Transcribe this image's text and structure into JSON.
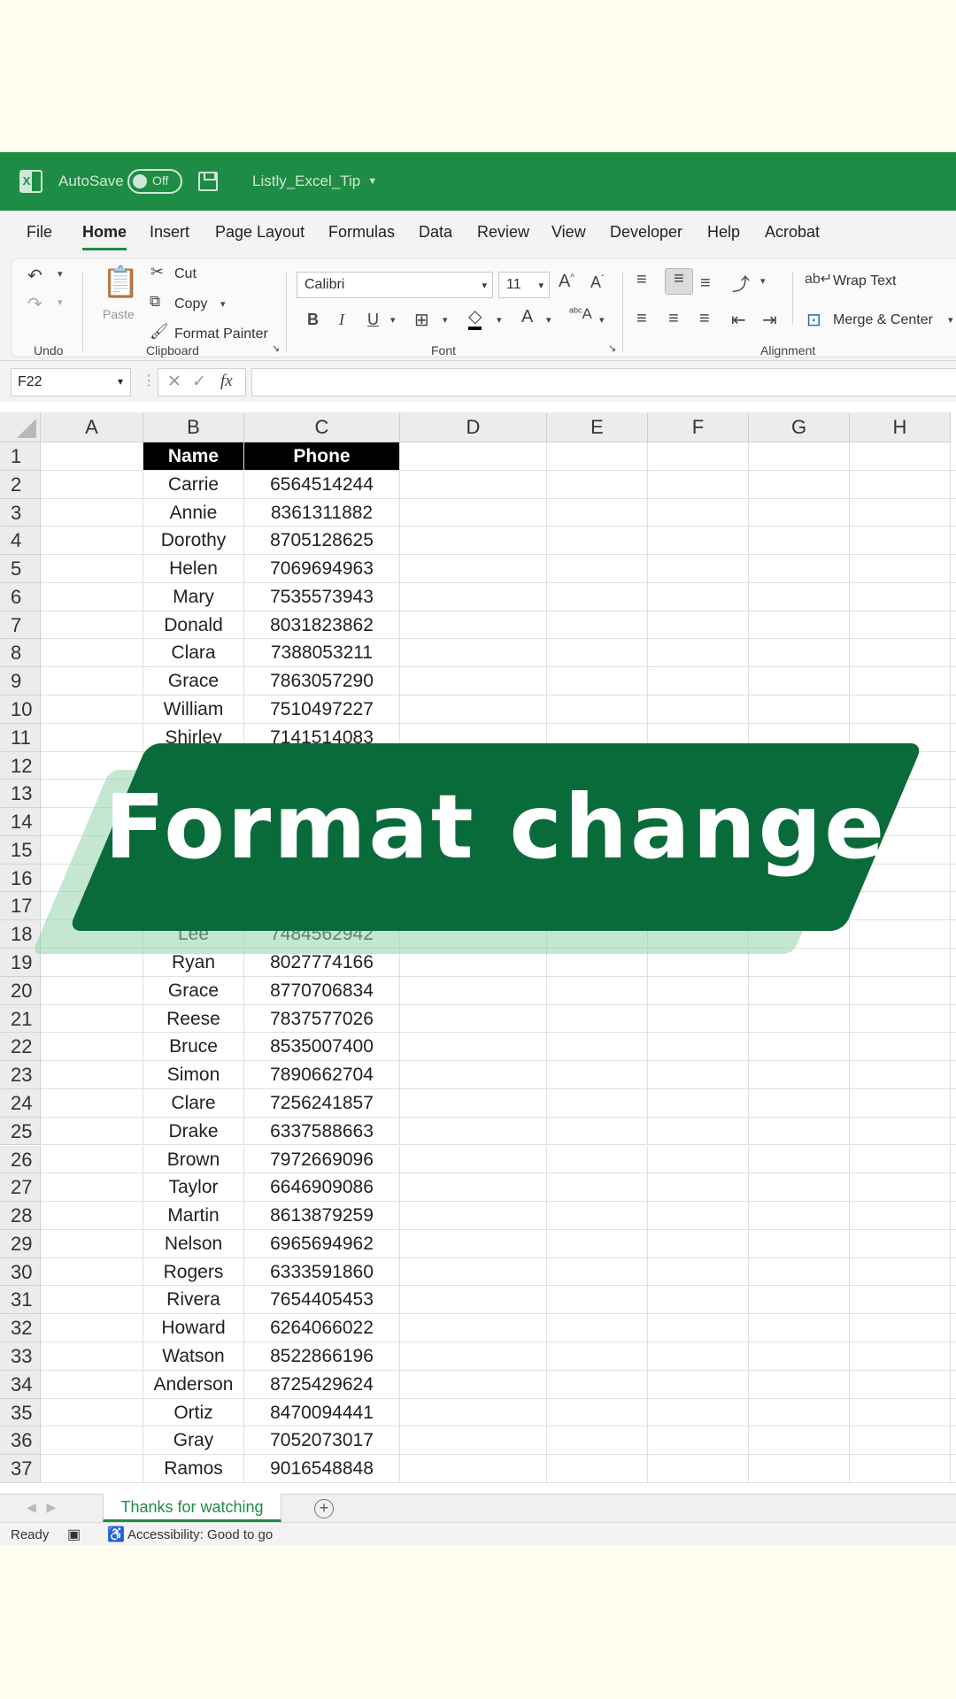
{
  "titlebar": {
    "autosave_label": "AutoSave",
    "autosave_state": "Off",
    "filename": "Listly_Excel_Tip"
  },
  "menu": [
    "File",
    "Home",
    "Insert",
    "Page Layout",
    "Formulas",
    "Data",
    "Review",
    "View",
    "Developer",
    "Help",
    "Acrobat"
  ],
  "ribbon": {
    "paste": "Paste",
    "cut": "Cut",
    "copy": "Copy",
    "format_painter": "Format Painter",
    "font_name": "Calibri",
    "font_size": "11",
    "bold": "B",
    "italic": "I",
    "underline": "U",
    "wrap_text": "Wrap Text",
    "merge_center": "Merge & Center",
    "groups": {
      "undo": "Undo",
      "clipboard": "Clipboard",
      "font": "Font",
      "alignment": "Alignment"
    }
  },
  "formula_bar": {
    "name_box": "F22",
    "fx": "fx",
    "formula": ""
  },
  "columns": [
    "A",
    "B",
    "C",
    "D",
    "E",
    "F",
    "G",
    "H"
  ],
  "table": {
    "headers": [
      "Name",
      "Phone"
    ],
    "rows": [
      {
        "r": "2",
        "name": "Carrie",
        "phone": "6564514244"
      },
      {
        "r": "3",
        "name": "Annie",
        "phone": "8361311882"
      },
      {
        "r": "4",
        "name": "Dorothy",
        "phone": "8705128625"
      },
      {
        "r": "5",
        "name": "Helen",
        "phone": "7069694963"
      },
      {
        "r": "6",
        "name": "Mary",
        "phone": "7535573943"
      },
      {
        "r": "7",
        "name": "Donald",
        "phone": "8031823862"
      },
      {
        "r": "8",
        "name": "Clara",
        "phone": "7388053211"
      },
      {
        "r": "9",
        "name": "Grace",
        "phone": "7863057290"
      },
      {
        "r": "10",
        "name": "William",
        "phone": "7510497227"
      },
      {
        "r": "11",
        "name": "Shirley",
        "phone": "7141514083"
      },
      {
        "r": "12",
        "name": "",
        "phone": ""
      },
      {
        "r": "13",
        "name": "",
        "phone": ""
      },
      {
        "r": "14",
        "name": "",
        "phone": ""
      },
      {
        "r": "15",
        "name": "",
        "phone": ""
      },
      {
        "r": "16",
        "name": "",
        "phone": ""
      },
      {
        "r": "17",
        "name": "",
        "phone": ""
      },
      {
        "r": "18",
        "name": "Lee",
        "phone": "7484562942"
      },
      {
        "r": "19",
        "name": "Ryan",
        "phone": "8027774166"
      },
      {
        "r": "20",
        "name": "Grace",
        "phone": "8770706834"
      },
      {
        "r": "21",
        "name": "Reese",
        "phone": "7837577026"
      },
      {
        "r": "22",
        "name": "Bruce",
        "phone": "8535007400"
      },
      {
        "r": "23",
        "name": "Simon",
        "phone": "7890662704"
      },
      {
        "r": "24",
        "name": "Clare",
        "phone": "7256241857"
      },
      {
        "r": "25",
        "name": "Drake",
        "phone": "6337588663"
      },
      {
        "r": "26",
        "name": "Brown",
        "phone": "7972669096"
      },
      {
        "r": "27",
        "name": "Taylor",
        "phone": "6646909086"
      },
      {
        "r": "28",
        "name": "Martin",
        "phone": "8613879259"
      },
      {
        "r": "29",
        "name": "Nelson",
        "phone": "6965694962"
      },
      {
        "r": "30",
        "name": "Rogers",
        "phone": "6333591860"
      },
      {
        "r": "31",
        "name": "Rivera",
        "phone": "7654405453"
      },
      {
        "r": "32",
        "name": "Howard",
        "phone": "6264066022"
      },
      {
        "r": "33",
        "name": "Watson",
        "phone": "8522866196"
      },
      {
        "r": "34",
        "name": "Anderson",
        "phone": "8725429624"
      },
      {
        "r": "35",
        "name": "Ortiz",
        "phone": "8470094441"
      },
      {
        "r": "36",
        "name": "Gray",
        "phone": "7052073017"
      },
      {
        "r": "37",
        "name": "Ramos",
        "phone": "9016548848"
      }
    ]
  },
  "banner": "Format change",
  "sheet_tab": "Thanks for watching",
  "status": {
    "ready": "Ready",
    "accessibility": "Accessibility: Good to go"
  },
  "colors": {
    "excel_green": "#1e8c45",
    "banner_green": "#0a6b3a",
    "background": "#fefdf0"
  }
}
